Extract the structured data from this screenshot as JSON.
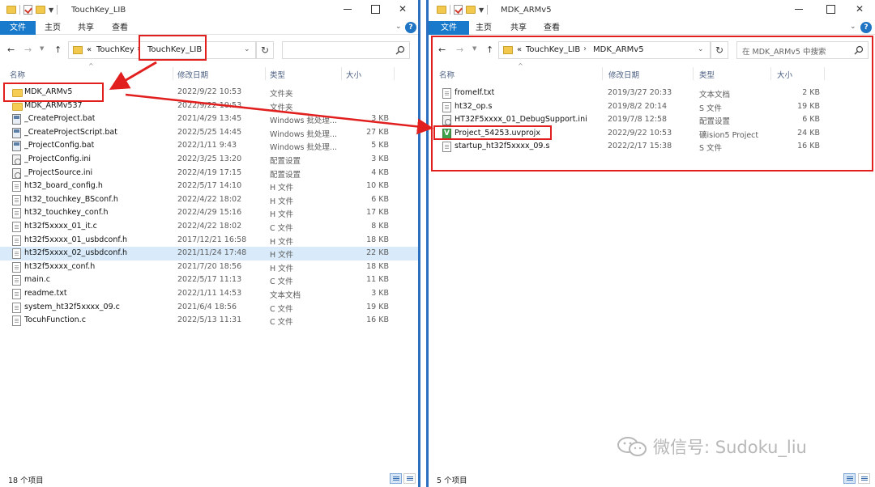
{
  "left": {
    "title": "TouchKey_LIB",
    "ribbon": [
      "文件",
      "主页",
      "共享",
      "查看"
    ],
    "breadcrumb": {
      "prefix": "«",
      "parent": "TouchKey",
      "current": "TouchKey_LIB"
    },
    "columns": {
      "name": "名称",
      "date": "修改日期",
      "type": "类型",
      "size": "大小"
    },
    "files": [
      {
        "name": "MDK_ARMv5",
        "date": "2022/9/22 10:53",
        "type": "文件夹",
        "size": "",
        "icon": "folder-icon"
      },
      {
        "name": "MDK_ARMv537",
        "date": "2022/9/22 10:53",
        "type": "文件夹",
        "size": "",
        "icon": "folder-icon"
      },
      {
        "name": "_CreateProject.bat",
        "date": "2021/4/29 13:45",
        "type": "Windows 批处理...",
        "size": "3 KB",
        "icon": "batch-file-icon"
      },
      {
        "name": "_CreateProjectScript.bat",
        "date": "2022/5/25 14:45",
        "type": "Windows 批处理...",
        "size": "27 KB",
        "icon": "batch-file-icon"
      },
      {
        "name": "_ProjectConfig.bat",
        "date": "2022/1/11 9:43",
        "type": "Windows 批处理...",
        "size": "5 KB",
        "icon": "batch-file-icon"
      },
      {
        "name": "_ProjectConfig.ini",
        "date": "2022/3/25 13:20",
        "type": "配置设置",
        "size": "3 KB",
        "icon": "config-file-icon"
      },
      {
        "name": "_ProjectSource.ini",
        "date": "2022/4/19 17:15",
        "type": "配置设置",
        "size": "4 KB",
        "icon": "config-file-icon"
      },
      {
        "name": "ht32_board_config.h",
        "date": "2022/5/17 14:10",
        "type": "H 文件",
        "size": "10 KB",
        "icon": "document-icon"
      },
      {
        "name": "ht32_touchkey_BSconf.h",
        "date": "2022/4/22 18:02",
        "type": "H 文件",
        "size": "6 KB",
        "icon": "document-icon"
      },
      {
        "name": "ht32_touchkey_conf.h",
        "date": "2022/4/29 15:16",
        "type": "H 文件",
        "size": "17 KB",
        "icon": "document-icon"
      },
      {
        "name": "ht32f5xxxx_01_it.c",
        "date": "2022/4/22 18:02",
        "type": "C 文件",
        "size": "8 KB",
        "icon": "document-icon"
      },
      {
        "name": "ht32f5xxxx_01_usbdconf.h",
        "date": "2017/12/21 16:58",
        "type": "H 文件",
        "size": "18 KB",
        "icon": "document-icon"
      },
      {
        "name": "ht32f5xxxx_02_usbdconf.h",
        "date": "2021/11/24 17:48",
        "type": "H 文件",
        "size": "22 KB",
        "icon": "document-icon",
        "selected": true
      },
      {
        "name": "ht32f5xxxx_conf.h",
        "date": "2021/7/20 18:56",
        "type": "H 文件",
        "size": "18 KB",
        "icon": "document-icon"
      },
      {
        "name": "main.c",
        "date": "2022/5/17 11:13",
        "type": "C 文件",
        "size": "11 KB",
        "icon": "document-icon"
      },
      {
        "name": "readme.txt",
        "date": "2022/1/11 14:53",
        "type": "文本文档",
        "size": "3 KB",
        "icon": "document-icon"
      },
      {
        "name": "system_ht32f5xxxx_09.c",
        "date": "2021/6/4 18:56",
        "type": "C 文件",
        "size": "19 KB",
        "icon": "document-icon"
      },
      {
        "name": "TocuhFunction.c",
        "date": "2022/5/13 11:31",
        "type": "C 文件",
        "size": "16 KB",
        "icon": "document-icon"
      }
    ],
    "status": "18 个项目"
  },
  "right": {
    "title": "MDK_ARMv5",
    "ribbon": [
      "文件",
      "主页",
      "共享",
      "查看"
    ],
    "breadcrumb": {
      "prefix": "«",
      "parent": "TouchKey_LIB",
      "current": "MDK_ARMv5"
    },
    "search_placeholder": "在 MDK_ARMv5 中搜索",
    "columns": {
      "name": "名称",
      "date": "修改日期",
      "type": "类型",
      "size": "大小"
    },
    "files": [
      {
        "name": "fromelf.txt",
        "date": "2019/3/27 20:33",
        "type": "文本文档",
        "size": "2 KB",
        "icon": "document-icon"
      },
      {
        "name": "ht32_op.s",
        "date": "2019/8/2 20:14",
        "type": "S 文件",
        "size": "19 KB",
        "icon": "document-icon"
      },
      {
        "name": "HT32F5xxxx_01_DebugSupport.ini",
        "date": "2019/7/8 12:58",
        "type": "配置设置",
        "size": "6 KB",
        "icon": "config-file-icon"
      },
      {
        "name": "Project_54253.uvprojx",
        "date": "2022/9/22 10:53",
        "type": "礦ision5 Project",
        "size": "24 KB",
        "icon": "uvision-project-icon"
      },
      {
        "name": "startup_ht32f5xxxx_09.s",
        "date": "2022/2/17 15:38",
        "type": "S 文件",
        "size": "16 KB",
        "icon": "document-icon"
      }
    ],
    "status": "5 个项目"
  },
  "watermark": "微信号: Sudoku_liu",
  "colors": {
    "accent": "#1979ca",
    "highlight": "#e21f1f",
    "selection": "#d9ebfa"
  }
}
